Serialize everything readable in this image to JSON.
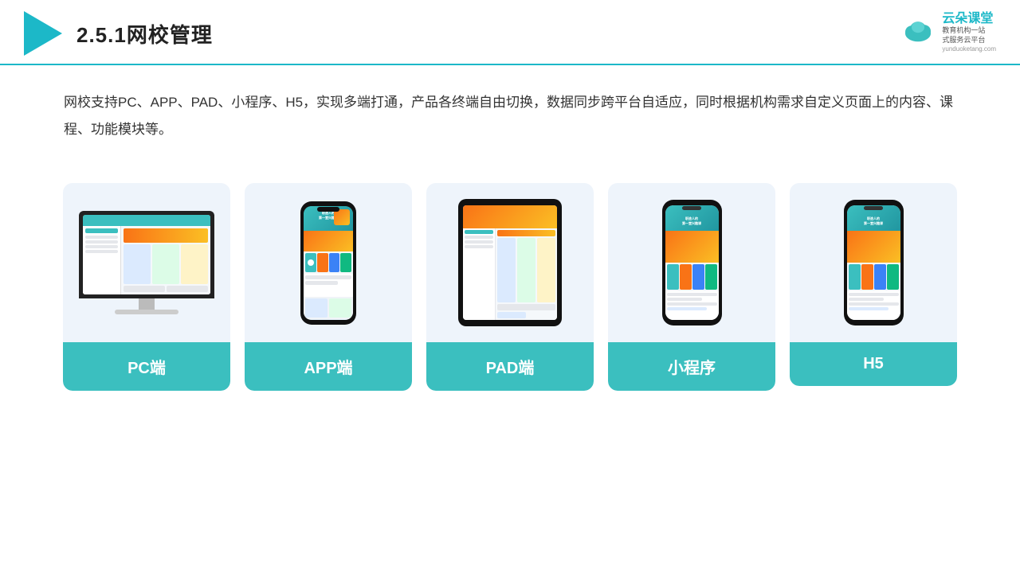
{
  "header": {
    "title": "2.5.1网校管理",
    "brand_name": "云朵课堂",
    "brand_sub": "yunduoketang.com",
    "brand_slogan1": "教育机构一站",
    "brand_slogan2": "式服务云平台"
  },
  "description": {
    "text": "网校支持PC、APP、PAD、小程序、H5，实现多端打通，产品各终端自由切换，数据同步跨平台自适应，同时根据机构需求自定义页面上的内容、课程、功能模块等。"
  },
  "cards": [
    {
      "id": "pc",
      "label": "PC端"
    },
    {
      "id": "app",
      "label": "APP端"
    },
    {
      "id": "pad",
      "label": "PAD端"
    },
    {
      "id": "mini",
      "label": "小程序"
    },
    {
      "id": "h5",
      "label": "H5"
    }
  ],
  "colors": {
    "accent": "#3bbfbf",
    "orange": "#f97316",
    "yellow": "#fbbf24",
    "card_bg": "#eef4fb",
    "dark": "#111",
    "text": "#333"
  }
}
